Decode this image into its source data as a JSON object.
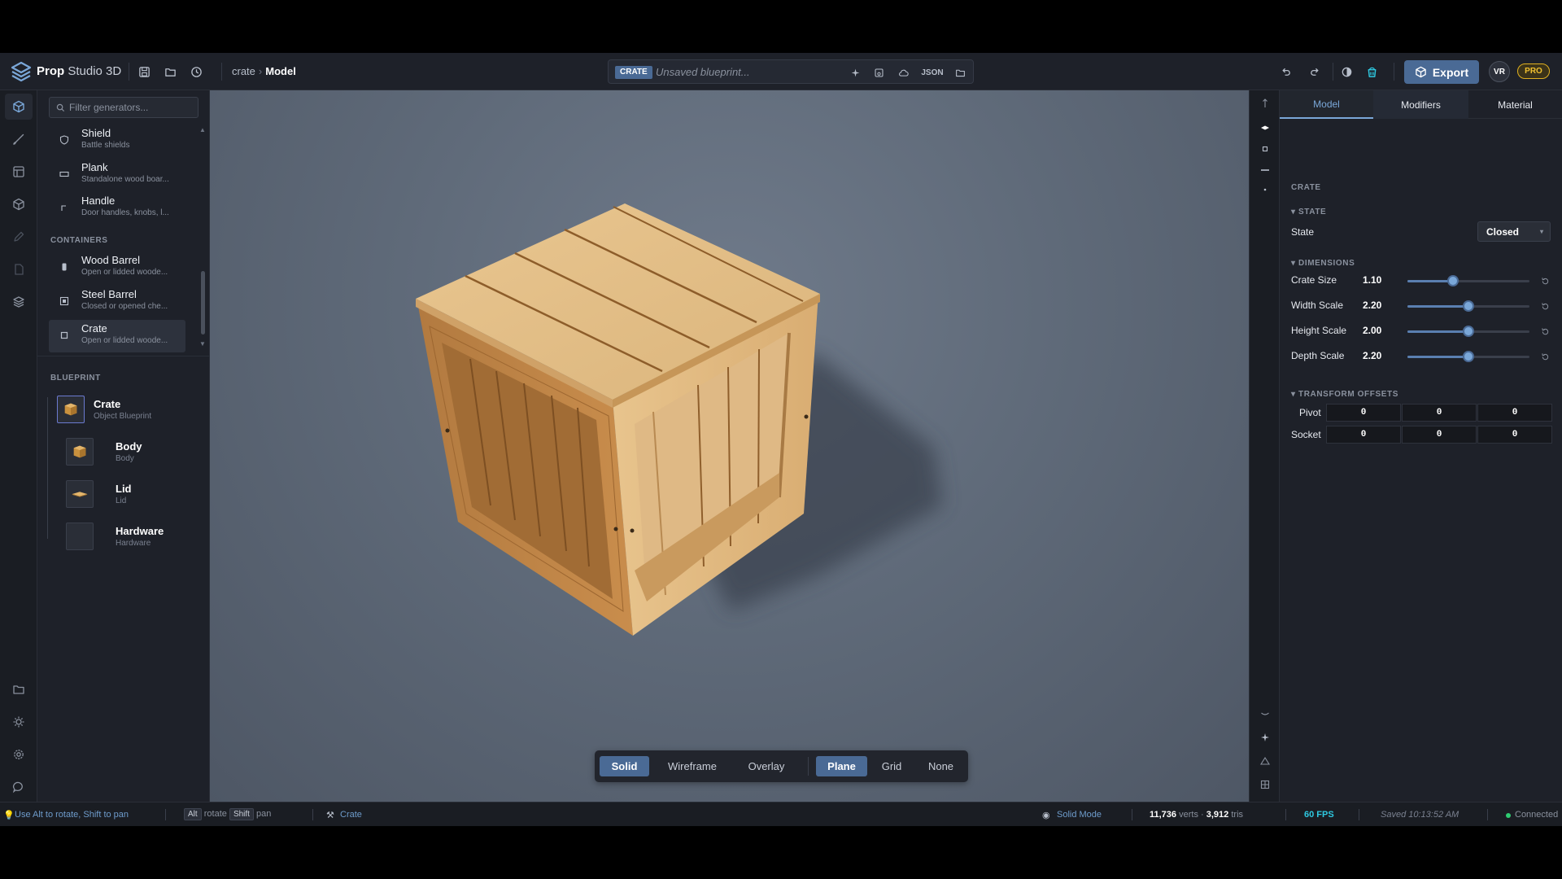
{
  "app": {
    "brand_bold": "Prop",
    "brand_rest": "Studio 3D"
  },
  "breadcrumb": {
    "parent": "crate",
    "current": "Model"
  },
  "blueprint_bar": {
    "tag": "CRATE",
    "placeholder": "Unsaved blueprint...",
    "json_label": "JSON"
  },
  "header_right": {
    "export_label": "Export",
    "vr_label": "VR",
    "pro_label": "PRO"
  },
  "generators": {
    "filter_placeholder": "Filter generators...",
    "misc_items": [
      {
        "name": "Shield",
        "desc": "Battle shields"
      },
      {
        "name": "Plank",
        "desc": "Standalone wood boar..."
      },
      {
        "name": "Handle",
        "desc": "Door handles, knobs, l..."
      }
    ],
    "containers_label": "CONTAINERS",
    "container_items": [
      {
        "name": "Wood Barrel",
        "desc": "Open or lidded woode..."
      },
      {
        "name": "Steel Barrel",
        "desc": "Closed or opened che..."
      },
      {
        "name": "Crate",
        "desc": "Open or lidded woode..."
      }
    ]
  },
  "blueprint": {
    "label": "BLUEPRINT",
    "root": {
      "name": "Crate",
      "sub": "Object Blueprint"
    },
    "children": [
      {
        "name": "Body",
        "sub": "Body"
      },
      {
        "name": "Lid",
        "sub": "Lid"
      },
      {
        "name": "Hardware",
        "sub": "Hardware"
      }
    ]
  },
  "viewport_bar": {
    "shading": [
      "Solid",
      "Wireframe",
      "Overlay"
    ],
    "shading_active": "Solid",
    "ground": [
      "Plane",
      "Grid",
      "None"
    ],
    "ground_active": "Plane"
  },
  "right_panel": {
    "tabs": [
      "Model",
      "Modifiers",
      "Material"
    ],
    "active_tab": "Model",
    "object_label": "CRATE",
    "state_section": "▾ STATE",
    "state_label": "State",
    "state_value": "Closed",
    "dimensions_section": "▾ DIMENSIONS",
    "dimensions": [
      {
        "label": "Crate Size",
        "value": "1.10",
        "fraction": 0.37
      },
      {
        "label": "Width Scale",
        "value": "2.20",
        "fraction": 0.5
      },
      {
        "label": "Height Scale",
        "value": "2.00",
        "fraction": 0.5
      },
      {
        "label": "Depth Scale",
        "value": "2.20",
        "fraction": 0.5
      }
    ],
    "transform_section": "▾ TRANSFORM OFFSETS",
    "offsets": [
      {
        "label": "Pivot",
        "values": [
          "0",
          "0",
          "0"
        ]
      },
      {
        "label": "Socket",
        "values": [
          "0",
          "0",
          "0"
        ]
      }
    ]
  },
  "status": {
    "hint": "Use Alt to rotate, Shift to pan",
    "alt_key": "Alt",
    "alt_action": "rotate",
    "shift_key": "Shift",
    "shift_action": "pan",
    "object": "Crate",
    "mode": "Solid Mode",
    "verts": "11,736",
    "verts_label": "verts",
    "tris": "3,912",
    "tris_label": "tris",
    "fps": "60 FPS",
    "saved": "Saved 10:13:52 AM",
    "connection": "Connected"
  },
  "colors": {
    "accent": "#4a6a95",
    "accent_light": "#7aa7d8",
    "pro_gold": "#f0c030",
    "fps_cyan": "#2ec8e0",
    "connected_green": "#2ecc71",
    "wood": "#d8b27a"
  }
}
